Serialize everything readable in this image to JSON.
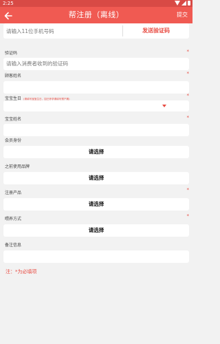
{
  "statusbar": {
    "time": "2:25"
  },
  "appbar": {
    "title": "帮注册（离线）",
    "submit_label": "提交"
  },
  "phone": {
    "placeholder": "请输入11位手机号码",
    "send_code_label": "发送验证码"
  },
  "verify": {
    "label": "验证码",
    "placeholder": "请输入消费者收到的验证码",
    "required": "*"
  },
  "customer_name": {
    "label": "顾客姓名",
    "required": "*"
  },
  "baby_birthday": {
    "label": "宝宝生日",
    "hint": "(请填写宝宝生日，如已怀孕请填写预产期)",
    "required": "*"
  },
  "baby_name": {
    "label": "宝宝姓名",
    "required": "*"
  },
  "member": {
    "label": "会员身份",
    "select_label": "请选择"
  },
  "previous_brand": {
    "label": "之前使用品牌",
    "select_label": "请选择"
  },
  "product": {
    "label": "注册产品",
    "select_label": "请选择",
    "required": "*"
  },
  "feeding": {
    "label": "喂养方式",
    "select_label": "请选择",
    "required": "*"
  },
  "remarks": {
    "label": "备注信息"
  },
  "note": "注：*为必填项",
  "colors": {
    "accent": "#f05a52",
    "required": "#e84c43",
    "background": "#f2f2f2"
  },
  "icons": {
    "back": "arrow-left-icon",
    "dropdown": "caret-down-icon"
  }
}
